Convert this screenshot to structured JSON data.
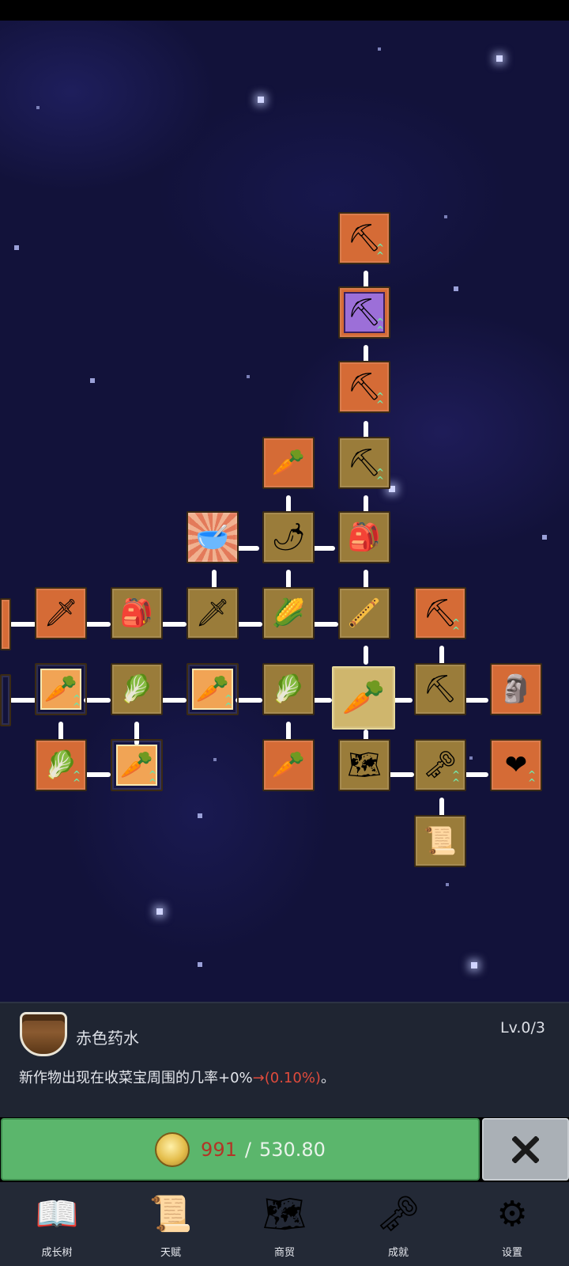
{
  "skill_tree": {
    "nodes": [
      {
        "name": "shovel-node-1",
        "icon": "shovel-icon",
        "glyph": "⛏",
        "style": "orange",
        "upgrade": true
      },
      {
        "name": "shovel-node-rare",
        "icon": "shovel-icon",
        "glyph": "⛏",
        "style": "purple",
        "upgrade": true
      },
      {
        "name": "shovel-node-2",
        "icon": "shovel-icon",
        "glyph": "⛏",
        "style": "orange",
        "upgrade": true
      },
      {
        "name": "shovel-node-3",
        "icon": "shovel-icon",
        "glyph": "⛏",
        "style": "olive",
        "upgrade": true
      },
      {
        "name": "radish-node",
        "icon": "radish-icon",
        "glyph": "🥕",
        "style": "orange",
        "upgrade": false
      },
      {
        "name": "potion-bowl-node",
        "icon": "bowl-icon",
        "glyph": "🥣",
        "style": "rays",
        "upgrade": false
      },
      {
        "name": "chili-node",
        "icon": "chili-icon",
        "glyph": "🌶",
        "style": "olive",
        "upgrade": false
      },
      {
        "name": "backpack-node-1",
        "icon": "backpack-icon",
        "glyph": "🎒",
        "style": "olive",
        "upgrade": false
      },
      {
        "name": "sword-node-1",
        "icon": "sword-icon",
        "glyph": "🗡",
        "style": "orange",
        "upgrade": false
      },
      {
        "name": "backpack-node-2",
        "icon": "backpack-icon",
        "glyph": "🎒",
        "style": "olive",
        "upgrade": false
      },
      {
        "name": "sword-node-2",
        "icon": "sword-icon",
        "glyph": "🗡",
        "style": "olive",
        "upgrade": false
      },
      {
        "name": "corn-node",
        "icon": "corn-icon",
        "glyph": "🌽",
        "style": "olive",
        "upgrade": false
      },
      {
        "name": "flute-node",
        "icon": "flute-icon",
        "glyph": "🪈",
        "style": "olive",
        "upgrade": false
      },
      {
        "name": "pickaxe-node-1",
        "icon": "pickaxe-icon",
        "glyph": "⛏",
        "style": "orange",
        "upgrade": true
      },
      {
        "name": "carrot-node-1",
        "icon": "carrot-icon",
        "glyph": "🥕",
        "style": "framed",
        "upgrade": true
      },
      {
        "name": "cabbage-node-1",
        "icon": "cabbage-icon",
        "glyph": "🥬",
        "style": "olive",
        "upgrade": false
      },
      {
        "name": "carrot-node-2",
        "icon": "carrot-icon",
        "glyph": "🥕",
        "style": "framed",
        "upgrade": true
      },
      {
        "name": "cabbage-node-2",
        "icon": "cabbage-icon",
        "glyph": "🥬",
        "style": "olive",
        "upgrade": false
      },
      {
        "name": "carrot-node-root",
        "icon": "carrot-icon",
        "glyph": "🥕",
        "style": "selected",
        "upgrade": false
      },
      {
        "name": "pickaxe-node-2",
        "icon": "pickaxe-icon",
        "glyph": "⛏",
        "style": "olive",
        "upgrade": false
      },
      {
        "name": "statue-node",
        "icon": "statue-icon",
        "glyph": "🗿",
        "style": "orange",
        "upgrade": false
      },
      {
        "name": "cabbage-node-3",
        "icon": "cabbage-icon",
        "glyph": "🥬",
        "style": "orange",
        "upgrade": true
      },
      {
        "name": "carrot-node-3",
        "icon": "carrot-icon",
        "glyph": "🥕",
        "style": "framed",
        "upgrade": true
      },
      {
        "name": "parsnip-node",
        "icon": "parsnip-icon",
        "glyph": "🥕",
        "style": "orange",
        "upgrade": false
      },
      {
        "name": "map-node",
        "icon": "map-icon",
        "glyph": "🗺",
        "style": "olive",
        "upgrade": false
      },
      {
        "name": "key-node",
        "icon": "key-icon",
        "glyph": "🗝",
        "style": "olive",
        "upgrade": true
      },
      {
        "name": "heart-node",
        "icon": "heart-icon",
        "glyph": "❤",
        "style": "orange",
        "upgrade": true
      },
      {
        "name": "scroll-node",
        "icon": "scroll-icon",
        "glyph": "📜",
        "style": "olive",
        "upgrade": false
      }
    ]
  },
  "info": {
    "item_name": "赤色药水",
    "level": "Lv.0/3",
    "desc_prefix": "新作物出现在收菜宝周围的几率+0%",
    "desc_arrow_value": "→(0.10%)",
    "desc_suffix": "。"
  },
  "purchase": {
    "coins_owned": "991",
    "separator": "/",
    "cost": "530.80"
  },
  "nav": [
    {
      "label": "成长树",
      "icon": "book-icon",
      "glyph": "📖"
    },
    {
      "label": "天赋",
      "icon": "scroll-icon",
      "glyph": "📜"
    },
    {
      "label": "商贸",
      "icon": "map-icon",
      "glyph": "🗺"
    },
    {
      "label": "成就",
      "icon": "key-icon",
      "glyph": "🗝"
    },
    {
      "label": "设置",
      "icon": "gear-icon",
      "glyph": "⚙"
    }
  ],
  "colors": {
    "background": "#12123a",
    "node_orange": "#d56b36",
    "node_olive": "#9a7c3a",
    "buy_green": "#5bb66c",
    "coins_red": "#b43426",
    "desc_red": "#e04b3c"
  }
}
